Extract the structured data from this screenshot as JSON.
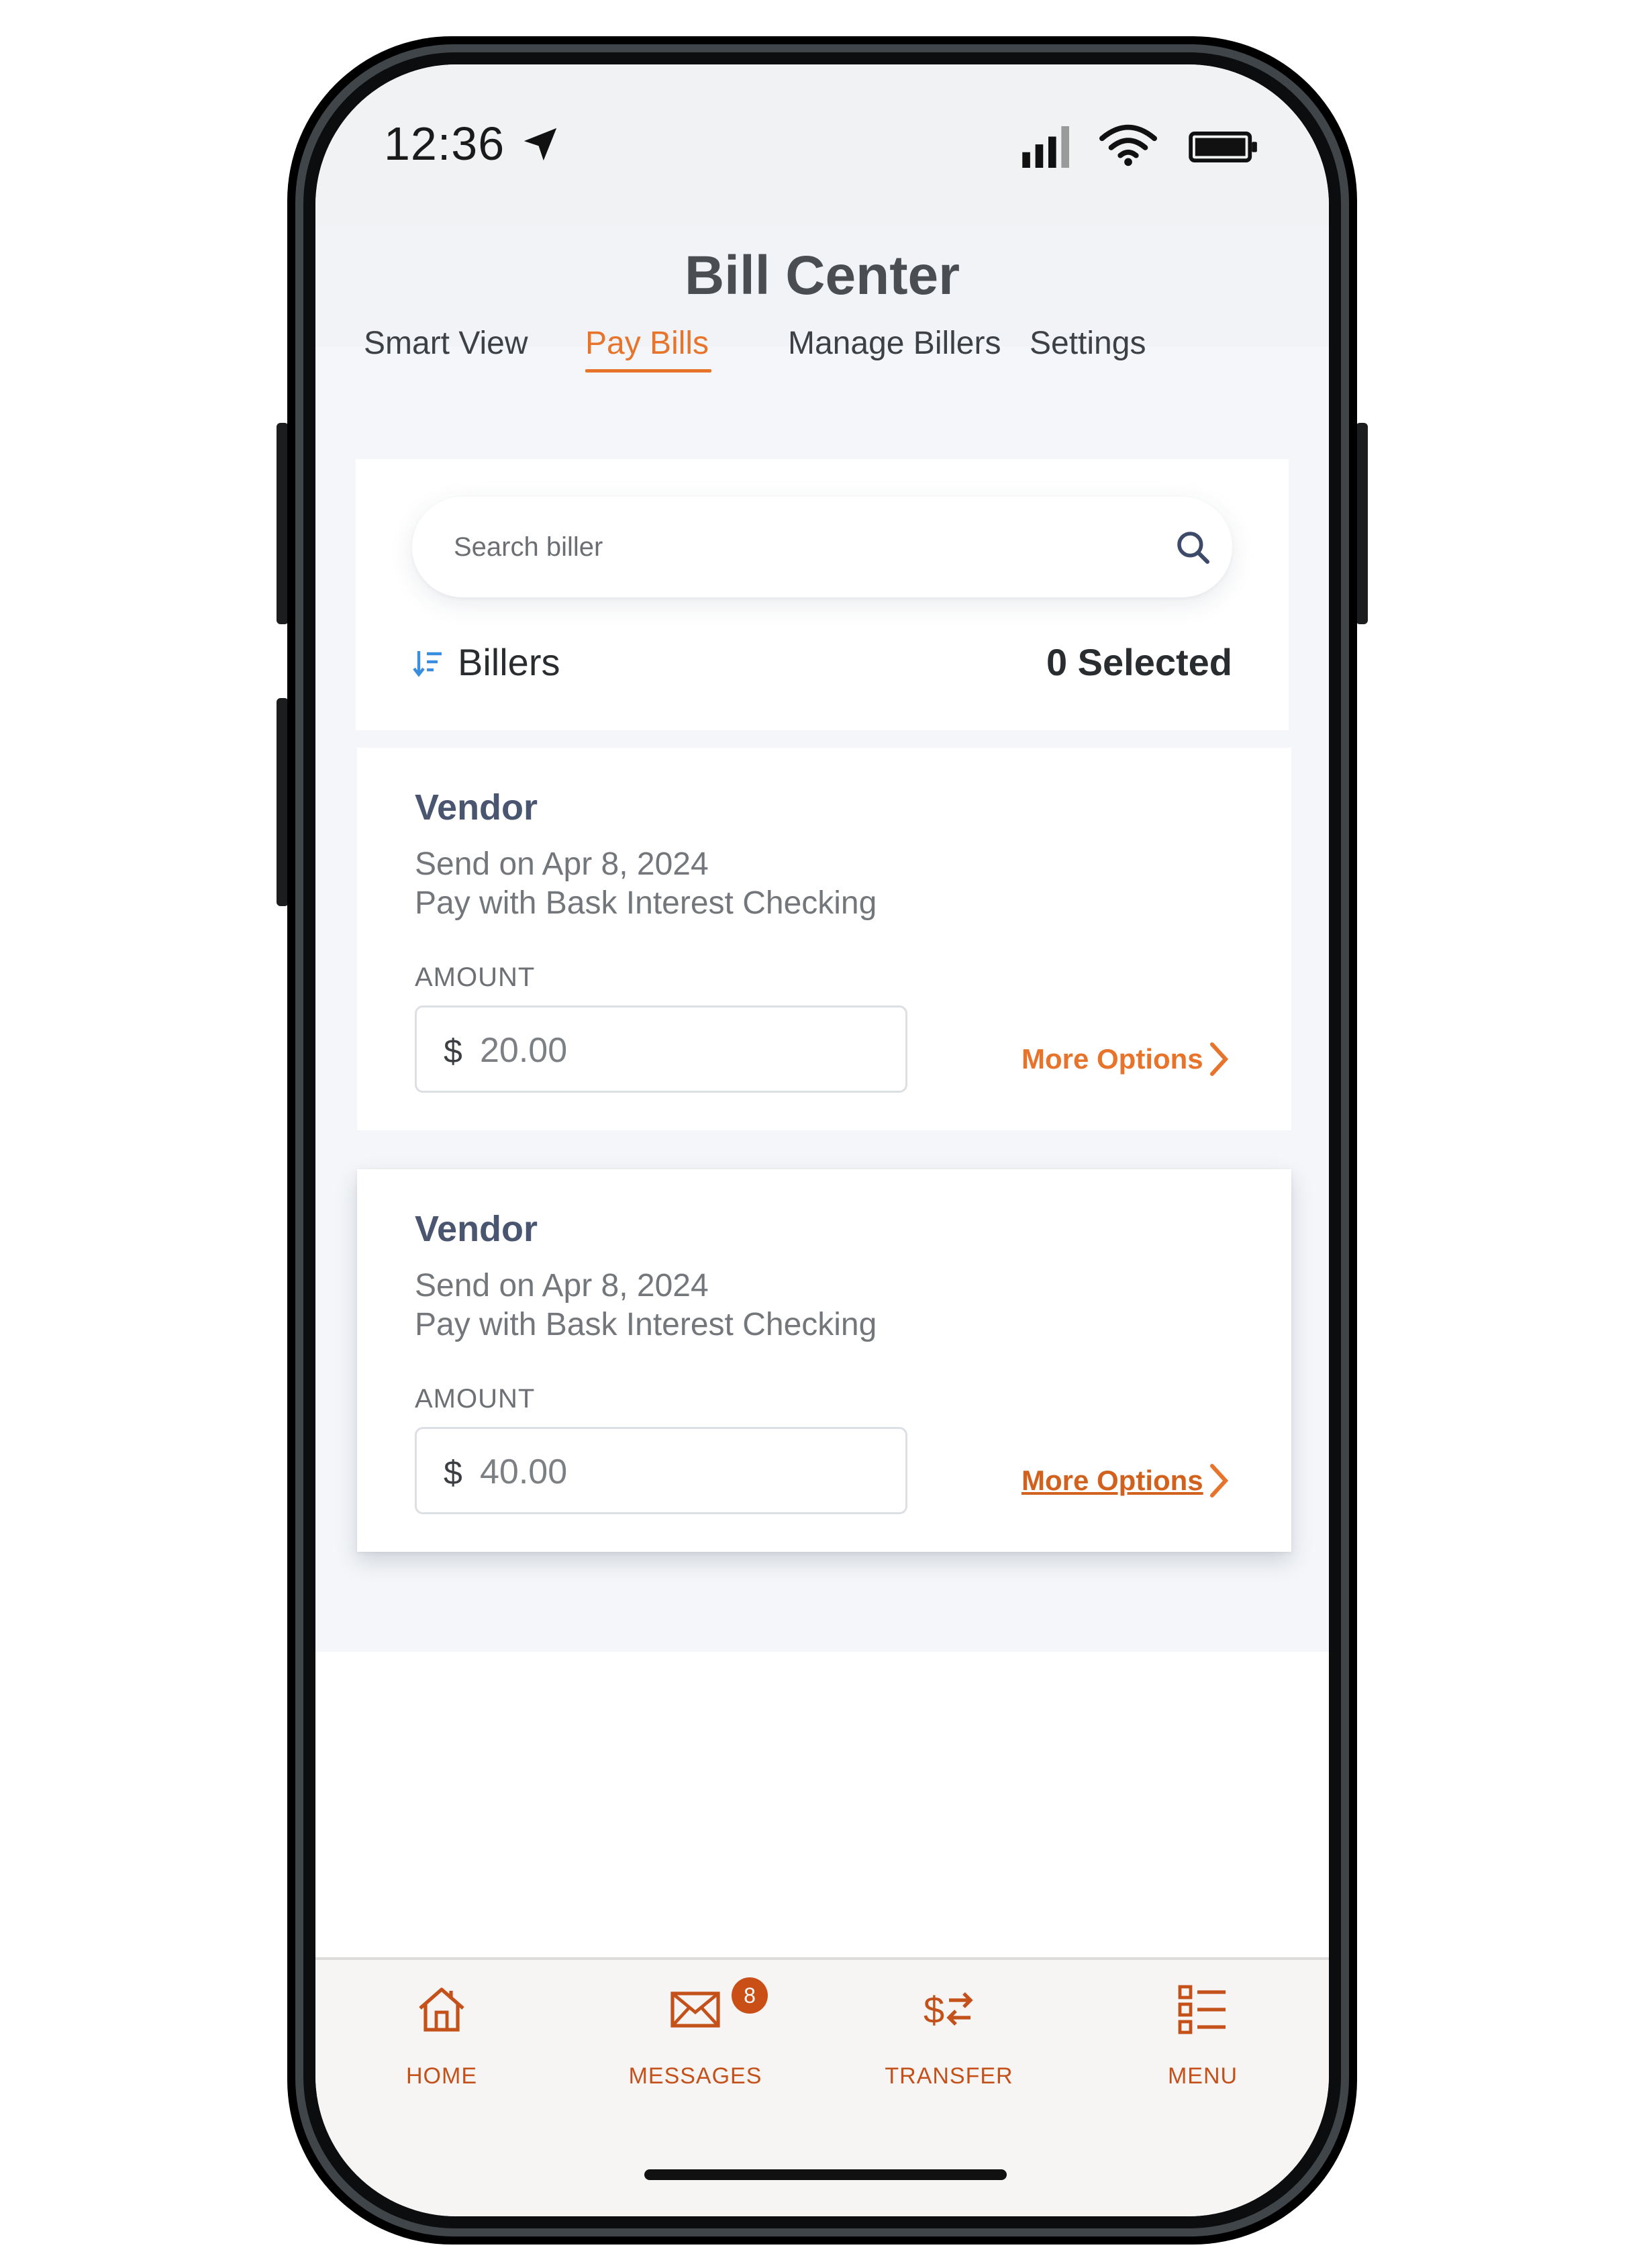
{
  "status_bar": {
    "time": "12:36"
  },
  "header": {
    "title": "Bill Center",
    "tabs": [
      {
        "label": "Smart View"
      },
      {
        "label": "Pay Bills",
        "active": true
      },
      {
        "label": "Manage Billers"
      },
      {
        "label": "Settings"
      }
    ]
  },
  "search": {
    "placeholder": "Search biller",
    "value": ""
  },
  "billers_header": {
    "label": "Billers",
    "selected": "0 Selected"
  },
  "billers": [
    {
      "name": "Vendor",
      "send_on": "Send on Apr 8, 2024",
      "pay_with": "Pay with Bask Interest Checking",
      "amount_label": "AMOUNT",
      "currency": "$",
      "amount": "20.00",
      "more_options": "More Options"
    },
    {
      "name": "Vendor",
      "send_on": "Send on Apr 8, 2024",
      "pay_with": "Pay with Bask Interest Checking",
      "amount_label": "AMOUNT",
      "currency": "$",
      "amount": "40.00",
      "more_options": "More Options"
    }
  ],
  "bottom_nav": {
    "items": [
      {
        "label": "HOME",
        "icon": "home-icon"
      },
      {
        "label": "MESSAGES",
        "icon": "envelope-icon",
        "badge": "8"
      },
      {
        "label": "TRANSFER",
        "icon": "transfer-icon"
      },
      {
        "label": "MENU",
        "icon": "menu-list-icon"
      }
    ]
  },
  "colors": {
    "accent": "#e8732a",
    "nav_accent": "#c4511a",
    "vendor_text": "#4a5570"
  }
}
